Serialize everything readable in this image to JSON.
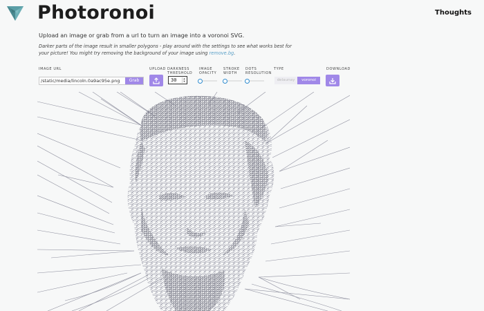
{
  "header": {
    "app_title": "Photoronoi",
    "nav": {
      "thoughts_label": "Thoughts"
    }
  },
  "intro": {
    "text": "Upload an image or grab from a url to turn an image into a voronoi SVG.",
    "note_before": "Darker parts of the image result in smaller polygons - play around with the settings to see what works best for your picture! You might try removing the background of your image using ",
    "note_link": "remove.bg",
    "note_after": "."
  },
  "controls": {
    "image_url": {
      "label": "IMAGE URL",
      "value": "/static/media/lincoln.0a9ac95e.png",
      "button": "Grab"
    },
    "upload": {
      "label": "UPLOAD",
      "icon": "upload-icon"
    },
    "darkness": {
      "label_line1": "DARKNESS",
      "label_line2": "THRESHOLD",
      "value": "30"
    },
    "opacity": {
      "label_line1": "IMAGE",
      "label_line2": "OPACITY",
      "level": 0
    },
    "stroke": {
      "label_line1": "STROKE",
      "label_line2": "WIDTH",
      "level": 0
    },
    "dots": {
      "label_line1": "DOTS",
      "label_line2": "RESOLUTION",
      "level": 0
    },
    "type": {
      "label": "TYPE",
      "options": [
        "delaunay",
        "voronoi"
      ],
      "selected": "voronoi"
    },
    "download": {
      "label": "DOWNLOAD",
      "icon": "download-icon"
    }
  },
  "colors": {
    "accent": "#a088e8",
    "slider_knob": "#2e8ccf",
    "logo": "#5a9ea6",
    "voronoi_stroke": "#8e8f9e",
    "link": "#5aa0c8"
  },
  "canvas": {
    "subject": "voronoi portrait"
  }
}
